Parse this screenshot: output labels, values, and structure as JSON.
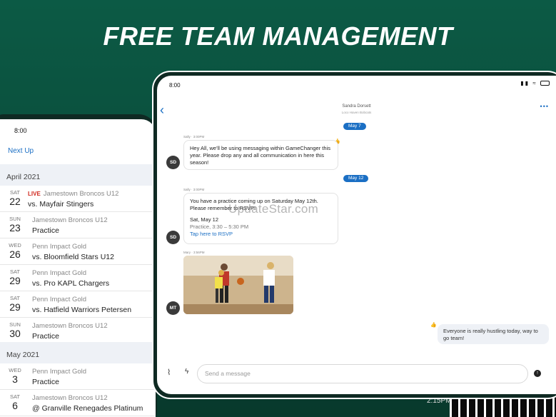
{
  "headline": "FREE TEAM MANAGEMENT",
  "left_panel": {
    "time": "8:00",
    "next_up": "Next Up",
    "bottom_time": "2:15PM",
    "sections": [
      {
        "month": "April 2021",
        "events": [
          {
            "dow": "SAT",
            "day": "22",
            "live": "LIVE",
            "team": "Jamestown Broncos U12",
            "title": "vs. Mayfair Stingers"
          },
          {
            "dow": "SUN",
            "day": "23",
            "team": "Jamestown Broncos U12",
            "title": "Practice"
          },
          {
            "dow": "WED",
            "day": "26",
            "team": "Penn Impact Gold",
            "title": "vs. Bloomfield Stars U12"
          },
          {
            "dow": "SAT",
            "day": "29",
            "team": "Penn Impact Gold",
            "title": "vs. Pro KAPL Chargers"
          },
          {
            "dow": "SAT",
            "day": "29",
            "team": "Penn Impact Gold",
            "title": "vs. Hatfield Warriors Petersen"
          },
          {
            "dow": "SUN",
            "day": "30",
            "team": "Jamestown Broncos U12",
            "title": "Practice"
          }
        ]
      },
      {
        "month": "May 2021",
        "events": [
          {
            "dow": "WED",
            "day": "3",
            "team": "Penn Impact Gold",
            "title": "Practice"
          },
          {
            "dow": "SAT",
            "day": "6",
            "team": "Jamestown Broncos U12",
            "title": "@ Granville Renegades Platinum"
          }
        ]
      }
    ]
  },
  "chat": {
    "time": "8:00",
    "contact_name": "Sandra Dorsett",
    "contact_sub": "Loco Haven Bobcats",
    "date_pills": [
      "May 7",
      "May 12"
    ],
    "messages": [
      {
        "meta": "Sally · 3:00PM",
        "avatar": "SD",
        "text": "Hey All, we'll be using messaging within GameChanger this year. Please drop any and all communication in here this season!"
      },
      {
        "meta": "Sally · 3:00PM",
        "avatar": "SD",
        "text": "You have a practice coming up on Saturday May 12th. Please remember to RSVP!",
        "event_date": "Sat, May 12",
        "event_detail": "Practice, 3:30 – 5:30 PM",
        "link": "Tap here to RSVP"
      },
      {
        "meta": "Mary · 3:56PM",
        "avatar": "MT"
      }
    ],
    "my_message": "Everyone is really hustling today, way to go team!",
    "composer_placeholder": "Send a message",
    "watermark": "UpdateStar.com"
  },
  "icons": {
    "back": "chevron-left-icon",
    "more": "more-dots-icon",
    "thumb": "thumbs-up-icon",
    "clip": "paperclip-icon",
    "bolt": "lightning-icon",
    "send": "send-icon"
  },
  "colors": {
    "background": "#0a4d3b",
    "accent": "#1b6fc4",
    "live": "#d0281e"
  }
}
